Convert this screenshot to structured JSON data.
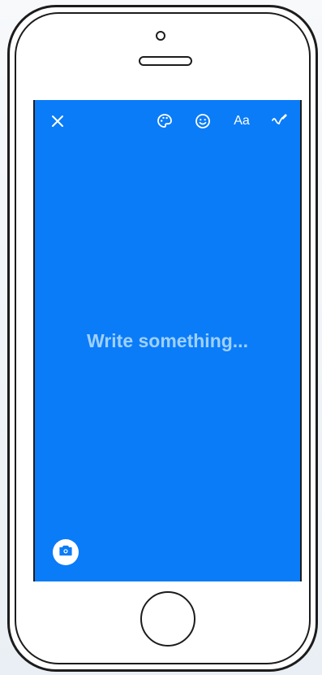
{
  "colors": {
    "screen_background": "#0a7cf8",
    "placeholder_text": "#9fd0ff",
    "icon_color": "#ffffff",
    "camera_icon_color": "#0a7cf8"
  },
  "toolbar": {
    "close_icon": "close-icon",
    "palette_icon": "palette-icon",
    "emoji_icon": "emoji-icon",
    "font_label": "Aa",
    "doodle_icon": "doodle-icon"
  },
  "composer": {
    "placeholder": "Write something..."
  },
  "bottom": {
    "camera_icon": "camera-icon"
  }
}
